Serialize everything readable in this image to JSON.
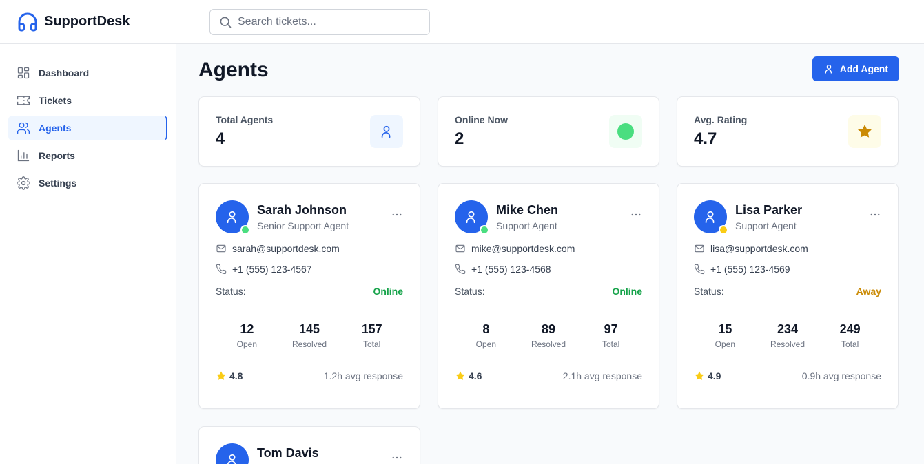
{
  "app": {
    "name": "SupportDesk"
  },
  "sidebar": {
    "items": [
      {
        "label": "Dashboard",
        "icon": "dashboard-icon",
        "active": false
      },
      {
        "label": "Tickets",
        "icon": "ticket-icon",
        "active": false
      },
      {
        "label": "Agents",
        "icon": "users-icon",
        "active": true
      },
      {
        "label": "Reports",
        "icon": "bar-chart-icon",
        "active": false
      },
      {
        "label": "Settings",
        "icon": "gear-icon",
        "active": false
      }
    ]
  },
  "search": {
    "placeholder": "Search tickets...",
    "value": ""
  },
  "page": {
    "title": "Agents",
    "add_button": "Add Agent"
  },
  "stats": [
    {
      "label": "Total Agents",
      "value": "4",
      "icon": "user-icon"
    },
    {
      "label": "Online Now",
      "value": "2",
      "icon": "online-dot-icon"
    },
    {
      "label": "Avg. Rating",
      "value": "4.7",
      "icon": "star-icon"
    }
  ],
  "status_label": "Status:",
  "count_labels": {
    "open": "Open",
    "resolved": "Resolved",
    "total": "Total"
  },
  "agents": [
    {
      "name": "Sarah Johnson",
      "role": "Senior Support Agent",
      "email": "sarah@supportdesk.com",
      "phone": "+1 (555) 123-4567",
      "status": "Online",
      "status_color": "#16a34a",
      "presence_color": "#4ade80",
      "open": "12",
      "resolved": "145",
      "total": "157",
      "rating": "4.8",
      "response": "1.2h avg response"
    },
    {
      "name": "Mike Chen",
      "role": "Support Agent",
      "email": "mike@supportdesk.com",
      "phone": "+1 (555) 123-4568",
      "status": "Online",
      "status_color": "#16a34a",
      "presence_color": "#4ade80",
      "open": "8",
      "resolved": "89",
      "total": "97",
      "rating": "4.6",
      "response": "2.1h avg response"
    },
    {
      "name": "Lisa Parker",
      "role": "Support Agent",
      "email": "lisa@supportdesk.com",
      "phone": "+1 (555) 123-4569",
      "status": "Away",
      "status_color": "#ca8a04",
      "presence_color": "#facc15",
      "open": "15",
      "resolved": "234",
      "total": "249",
      "rating": "4.9",
      "response": "0.9h avg response"
    },
    {
      "name": "Tom Davis"
    }
  ],
  "colors": {
    "accent": "#2563eb",
    "star": "#facc15",
    "star_dark": "#ca8a04"
  }
}
